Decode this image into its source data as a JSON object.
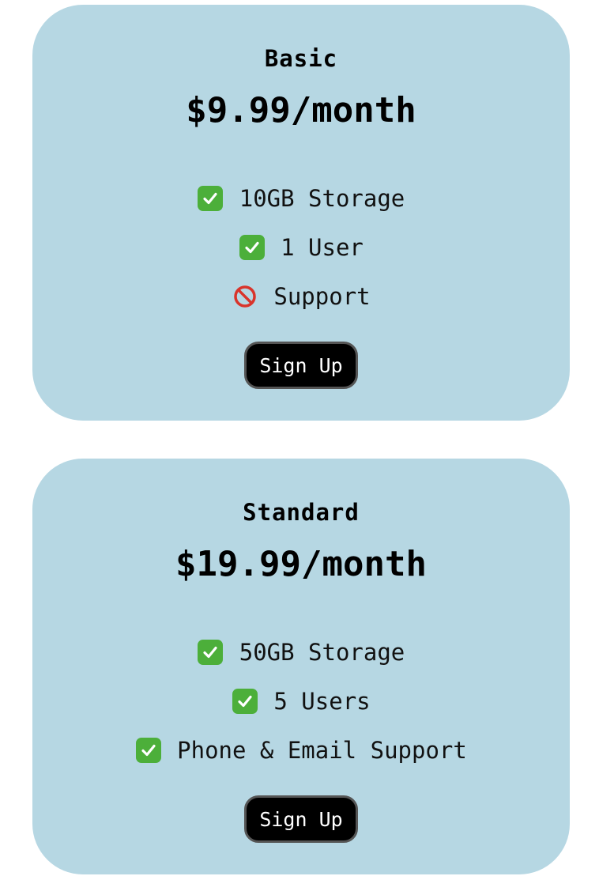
{
  "plans": [
    {
      "name": "Basic",
      "price": "$9.99/month",
      "features": [
        {
          "icon": "check-icon",
          "text": "10GB Storage",
          "included": true
        },
        {
          "icon": "check-icon",
          "text": "1 User",
          "included": true
        },
        {
          "icon": "prohibited-icon",
          "text": "Support",
          "included": false
        }
      ],
      "button_label": "Sign Up"
    },
    {
      "name": "Standard",
      "price": "$19.99/month",
      "features": [
        {
          "icon": "check-icon",
          "text": "50GB Storage",
          "included": true
        },
        {
          "icon": "check-icon",
          "text": "5 Users",
          "included": true
        },
        {
          "icon": "check-icon",
          "text": "Phone & Email Support",
          "included": true
        }
      ],
      "button_label": "Sign Up"
    }
  ],
  "colors": {
    "card_background": "#b6d7e3",
    "button_background": "#000000",
    "check_green": "#4caf3a",
    "prohibited_red": "#d9342b"
  }
}
